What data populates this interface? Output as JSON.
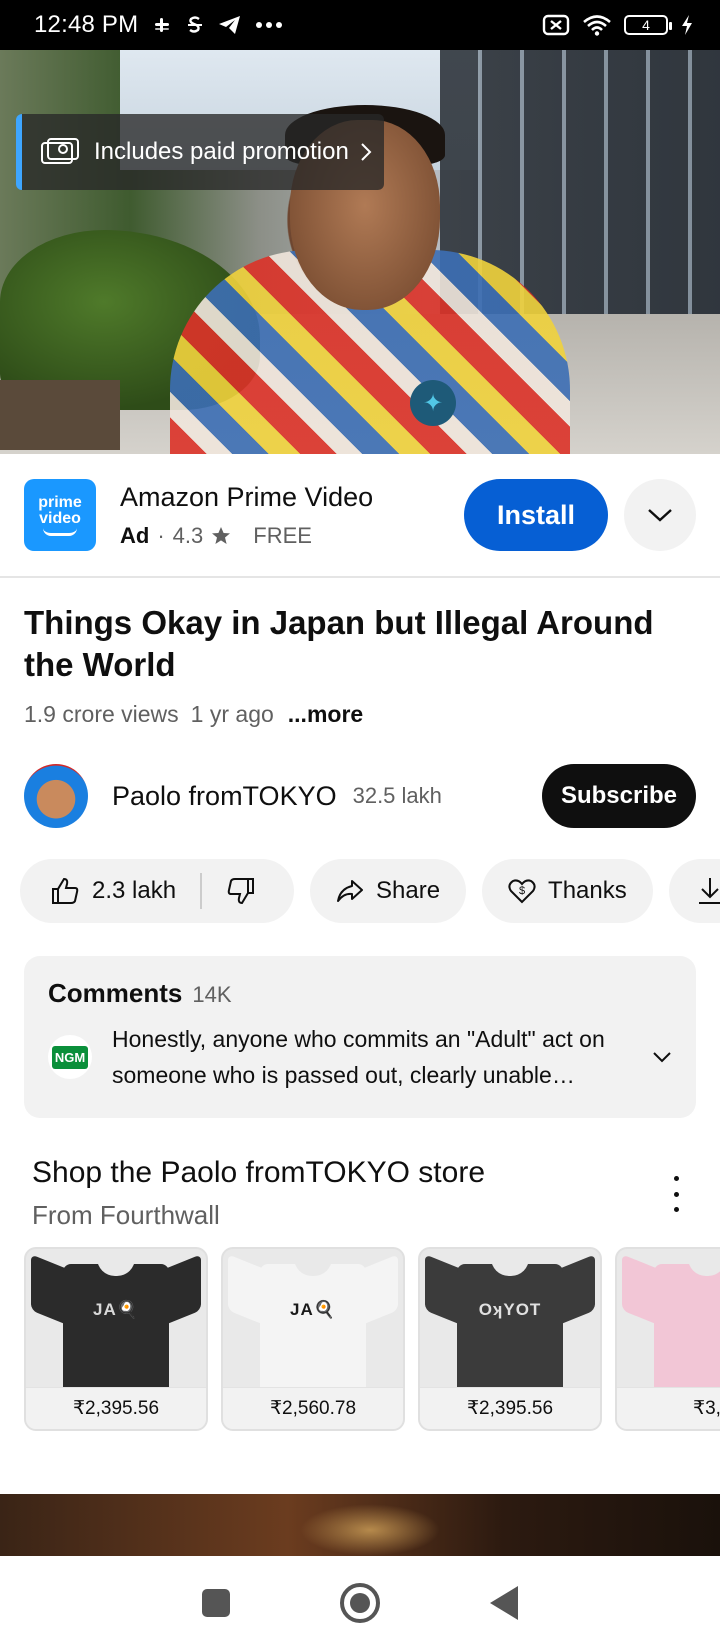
{
  "status_bar": {
    "time": "12:48 PM",
    "icons": [
      "slack-icon",
      "s-icon",
      "telegram-icon",
      "more-dots-icon"
    ],
    "right_icons": [
      "no-sim-icon",
      "wifi-icon",
      "battery-icon",
      "charging-icon"
    ],
    "battery_level": "4"
  },
  "video": {
    "paid_promotion_label": "Includes paid promotion"
  },
  "ad": {
    "app_logo_line1": "prime",
    "app_logo_line2": "video",
    "app_name": "Amazon Prime Video",
    "ad_tag": "Ad",
    "separator": "·",
    "rating": "4.3",
    "price": "FREE",
    "install_label": "Install"
  },
  "video_info": {
    "title": "Things Okay in Japan but Illegal Around the World",
    "views": "1.9 crore views",
    "age": "1 yr ago",
    "more_label": "...more"
  },
  "channel": {
    "name": "Paolo fromTOKYO",
    "subscribers": "32.5 lakh",
    "subscribe_label": "Subscribe"
  },
  "actions": {
    "likes": "2.3 lakh",
    "share_label": "Share",
    "thanks_label": "Thanks"
  },
  "comments": {
    "header": "Comments",
    "count": "14K",
    "avatar_text": "NGM",
    "preview": "Honestly, anyone who commits an \"Adult\" act on someone who is passed out, clearly unable…"
  },
  "store": {
    "title": "Shop the Paolo fromTOKYO store",
    "subtitle": "From Fourthwall",
    "products": [
      {
        "print": "JA🍳",
        "price": "₹2,395.56",
        "shirt_color": "#2b2b2b",
        "print_color": "#d8d8d8"
      },
      {
        "print": "JA🍳",
        "price": "₹2,560.78",
        "shirt_color": "#f4f4f4",
        "print_color": "#1a1a1a"
      },
      {
        "print": "OʞYOT",
        "price": "₹2,395.56",
        "shirt_color": "#3b3b3b",
        "print_color": "#e0e0e0"
      },
      {
        "print": "",
        "price": "₹3,",
        "shirt_color": "#f2c6d6",
        "print_color": "#f2c6d6"
      }
    ]
  },
  "colors": {
    "accent_blue": "#065fd4",
    "promo_bar": "#3ea6ff",
    "subscribe_bg": "#0f0f0f",
    "chip_bg": "#f2f2f2"
  }
}
